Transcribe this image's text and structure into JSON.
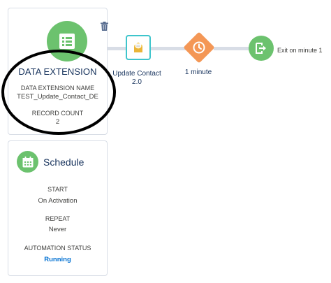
{
  "entry_source": {
    "title": "DATA EXTENSION",
    "name_label": "DATA EXTENSION NAME",
    "name_value": "TEST_Update_Contact_DE",
    "count_label": "RECORD COUNT",
    "count_value": "2",
    "icon": "list-icon"
  },
  "schedule": {
    "title": "Schedule",
    "start_label": "START",
    "start_value": "On Activation",
    "repeat_label": "REPEAT",
    "repeat_value": "Never",
    "status_label": "AUTOMATION STATUS",
    "status_value": "Running",
    "icon": "calendar-icon"
  },
  "activities": [
    {
      "label": "Update Contact 2.0",
      "label_line1": "Update Contact",
      "label_line2": "2.0",
      "icon": "email-icon"
    },
    {
      "label": "1 minute",
      "icon": "clock-icon"
    },
    {
      "label": "Exit on minute 1",
      "icon": "exit-icon"
    }
  ],
  "colors": {
    "green": "#6cc26e",
    "orange": "#f49756",
    "teal": "#3ec5cc",
    "link_blue": "#0070d2",
    "title_navy": "#16325c",
    "connector": "#d8dde6"
  }
}
